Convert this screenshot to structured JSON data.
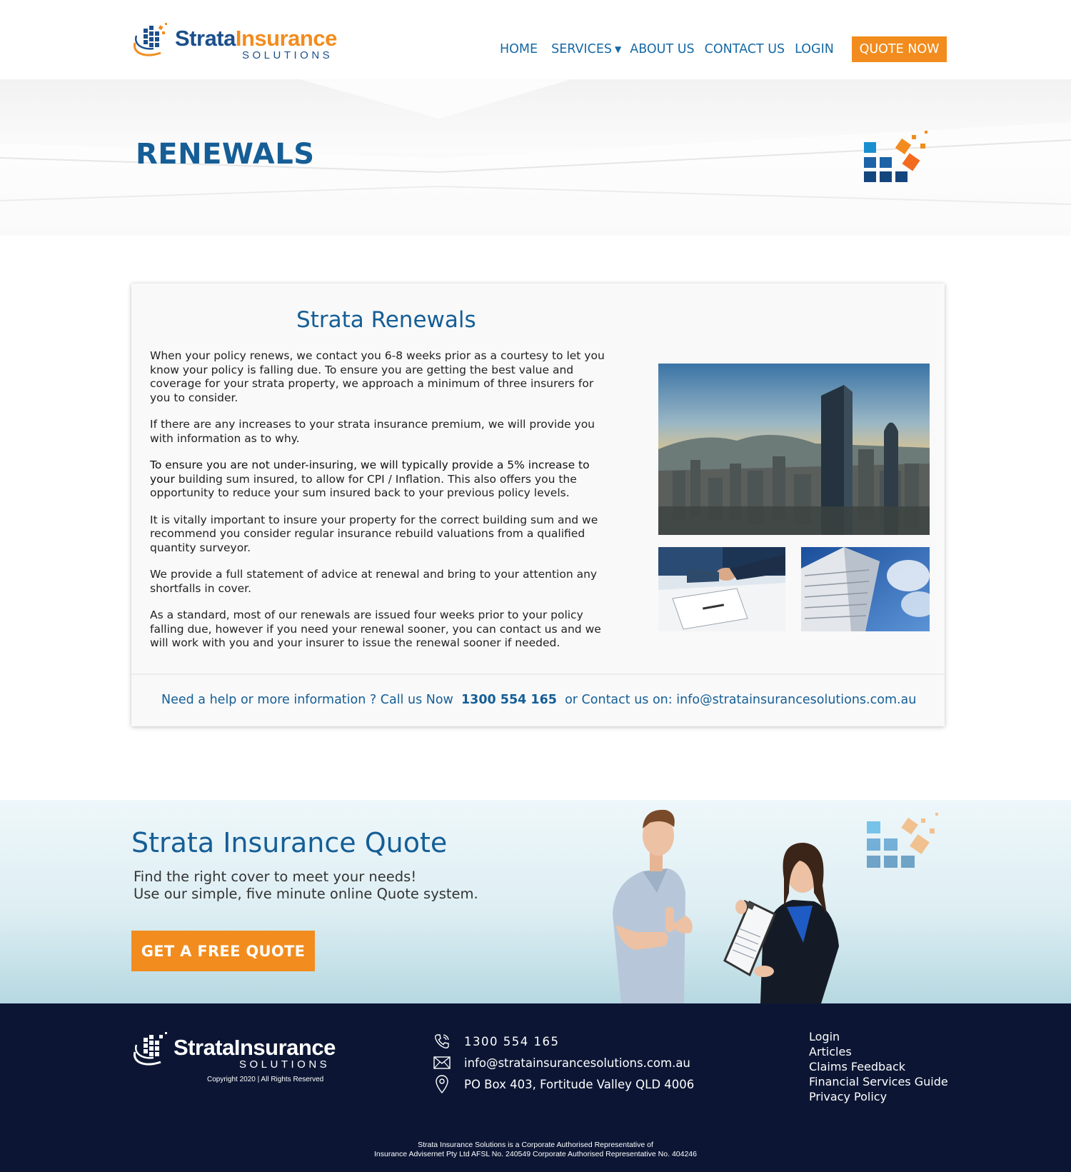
{
  "header": {
    "logo": {
      "word1": "Strata",
      "word2": "Insurance",
      "sub": "SOLUTIONS"
    },
    "nav": [
      {
        "label": "HOME"
      },
      {
        "label": "SERVICES"
      },
      {
        "label": "ABOUT US"
      },
      {
        "label": "CONTACT US"
      },
      {
        "label": "LOGIN"
      }
    ],
    "quote_now": "QUOTE NOW"
  },
  "hero": {
    "title": "RENEWALS"
  },
  "content": {
    "title": "Strata Renewals",
    "paragraphs": [
      "When your policy renews, we contact you 6-8 weeks prior as a courtesy to let you know your policy is falling due.  To ensure you are getting the best value and coverage for your strata property, we approach a minimum of three insurers for you to consider.",
      "If there are any increases to your strata insurance premium, we will provide you with information as to why.",
      "building sum insured, to allow for CPI / Inflation. This also offers you the opportunity to reduce your sum insured back to your previous policy levels.",
      "It is vitally important to insure your property for the correct building sum and we recommend you consider regular insurance rebuild valuations from a qualified quantity surveyor.",
      "We provide a full statement of advice at renewal and bring to your attention any shortfalls in cover.",
      "As a standard, most of our renewals are issued four weeks prior to your policy falling due, however if you need your renewal sooner, you can contact us and we will work with you and your insurer to issue the renewal sooner if needed."
    ],
    "lead_in": "To ensure you are not under-insuring, we will typically provide a 5% increase to your",
    "cta": {
      "prefix": "Need a help or more information ? Call us Now",
      "phone": "1300 554 165",
      "middle": "or  Contact us on:",
      "email": "info@stratainsurancesolutions.com.au"
    }
  },
  "quote": {
    "title": "Strata Insurance Quote",
    "line1": "Find the right cover to meet  your  needs!",
    "line2": "Use our simple, five minute online Quote system.",
    "button": "GET A FREE QUOTE"
  },
  "footer": {
    "logo": {
      "word": "StrataInsurance",
      "sub": "SOLUTIONS"
    },
    "copyright": "Copyright 2020 | All Rights Reserved",
    "phone": "1300 554 165",
    "email": "info@stratainsurancesolutions.com.au",
    "address": "PO Box 403, Fortitude Valley QLD 4006",
    "links": [
      {
        "label": "Login"
      },
      {
        "label": "Articles"
      },
      {
        "label": "Claims Feedback"
      },
      {
        "label": "Financial Services Guide"
      },
      {
        "label": "Privacy Policy"
      }
    ],
    "disclaimer_line1": "Strata Insurance Solutions is a Corporate Authorised Representative of",
    "disclaimer_line2": "Insurance Advisernet Pty Ltd AFSL No. 240549  Corporate Authorised Representative No. 404246"
  },
  "colors": {
    "brand_blue": "#155e96",
    "brand_orange": "#f28c1e",
    "footer_bg": "#0c1634"
  },
  "icons": [
    "logo-mark-icon",
    "caret-down-icon",
    "phone-icon",
    "mail-icon",
    "location-pin-icon"
  ]
}
